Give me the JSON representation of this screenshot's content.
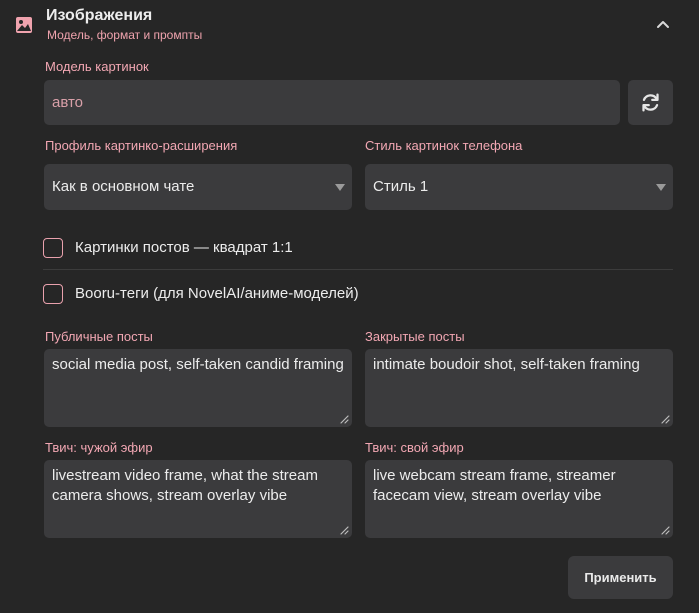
{
  "header": {
    "icon": "image-icon",
    "title": "Изображения",
    "subtitle": "Модель, формат и промпты",
    "collapse_icon": "chevron-up-icon"
  },
  "model": {
    "label": "Модель картинок",
    "value": "авто",
    "refresh_icon": "refresh-icon"
  },
  "profile": {
    "label": "Профиль картинко-расширения",
    "selected": "Как в основном чате"
  },
  "phone_style": {
    "label": "Стиль картинок телефона",
    "selected": "Стиль 1"
  },
  "checkboxes": {
    "square": {
      "label": "Картинки постов — квадрат 1:1",
      "checked": false
    },
    "booru": {
      "label": "Booru-теги (для NovelAI/аниме-моделей)",
      "checked": false
    }
  },
  "prompts": {
    "public": {
      "label": "Публичные посты",
      "value": "social media post, self-taken candid framing"
    },
    "private": {
      "label": "Закрытые посты",
      "value": "intimate boudoir shot, self-taken framing"
    },
    "twitch_other": {
      "label": "Твич: чужой эфир",
      "value": "livestream video frame, what the stream camera shows, stream overlay vibe"
    },
    "twitch_own": {
      "label": "Твич: свой эфир",
      "value": "live webcam stream frame, streamer facecam view, stream overlay vibe"
    }
  },
  "apply_label": "Применить",
  "colors": {
    "background": "#262626",
    "field": "#3b3b3d",
    "accent_pink": "#f2a7b3"
  }
}
